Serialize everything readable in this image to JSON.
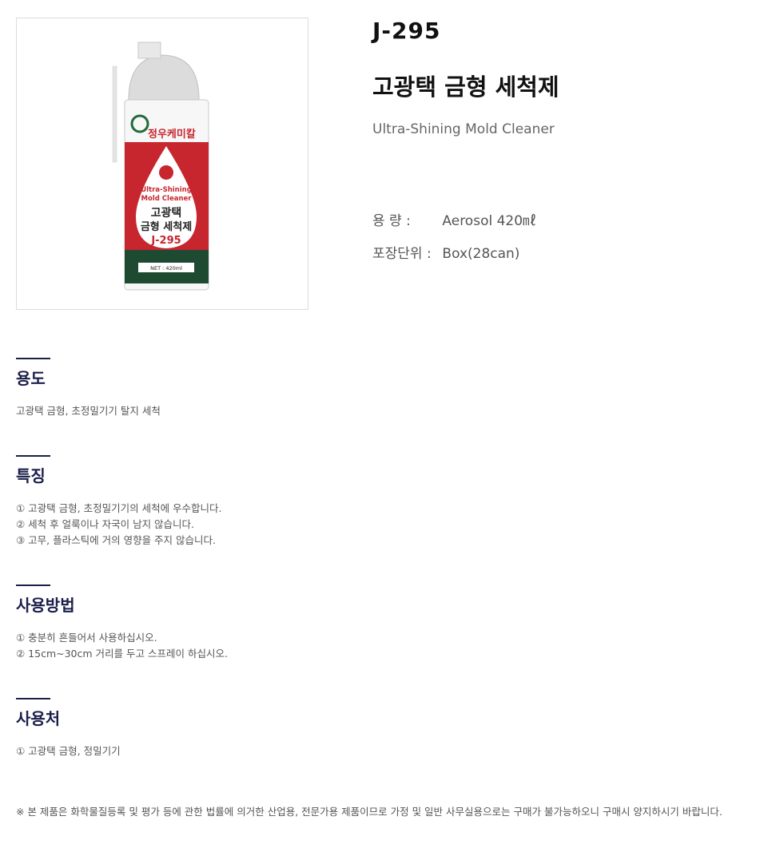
{
  "product": {
    "code": "J-295",
    "title_ko": "고광택 금형 세척제",
    "title_en": "Ultra-Shining Mold Cleaner",
    "image": {
      "brand_text": "정우케미칼",
      "label_en_1": "Ultra-Shining",
      "label_en_2": "Mold Cleaner",
      "label_ko_1": "고광택",
      "label_ko_2": "금형 세척제",
      "label_code": "J-295",
      "net": "NET : 420ml"
    }
  },
  "specs": [
    {
      "label": "용    량 :",
      "value": "Aerosol 420㎖"
    },
    {
      "label": "포장단위 :",
      "value": "Box(28can)"
    }
  ],
  "sections": [
    {
      "title": "용도",
      "lines": [
        "고광택 금형, 초정밀기기 탈지 세척"
      ]
    },
    {
      "title": "특징",
      "lines": [
        "① 고광택 금형, 초정밀기기의 세척에 우수합니다.",
        "② 세척 후 얼룩이나 자국이 남지 않습니다.",
        "③ 고무, 플라스틱에 거의 영향을 주지 않습니다."
      ]
    },
    {
      "title": "사용방법",
      "lines": [
        "① 충분히 흔들어서 사용하십시오.",
        "② 15cm~30cm 거리를 두고 스프레이 하십시오."
      ]
    },
    {
      "title": "사용처",
      "lines": [
        "① 고광택 금형, 정밀기기"
      ]
    }
  ],
  "footnote": "※ 본 제품은 화학물질등록 및 평가 등에 관한 법률에 의거한 산업용, 전문가용 제품이므로 가정 및 일반 사무실용으로는 구매가 불가능하오니 구매시 양지하시기 바랍니다."
}
